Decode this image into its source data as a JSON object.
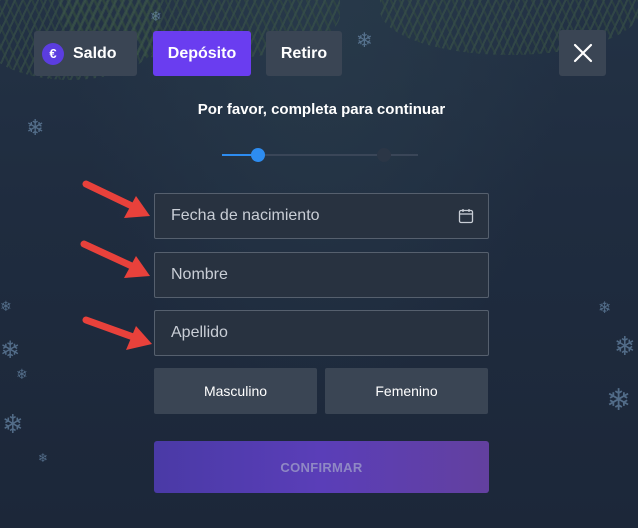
{
  "tabs": [
    {
      "label": "Saldo",
      "icon": "euro-icon",
      "active": false
    },
    {
      "label": "Depósito",
      "active": true
    },
    {
      "label": "Retiro",
      "active": false
    }
  ],
  "balance_icon_symbol": "€",
  "subtitle": "Por favor, completa para continuar",
  "progress": {
    "current_step": 1,
    "total_steps": 2
  },
  "fields": {
    "birthdate": {
      "placeholder": "Fecha de nacimiento",
      "value": ""
    },
    "first_name": {
      "placeholder": "Nombre",
      "value": ""
    },
    "last_name": {
      "placeholder": "Apellido",
      "value": ""
    }
  },
  "gender": {
    "male_label": "Masculino",
    "female_label": "Femenino"
  },
  "confirm_label": "CONFIRMAR",
  "colors": {
    "active_tab": "#6a3df0",
    "progress": "#2d8cf0",
    "arrow": "#e8413b",
    "background": "#1f2b3d"
  }
}
